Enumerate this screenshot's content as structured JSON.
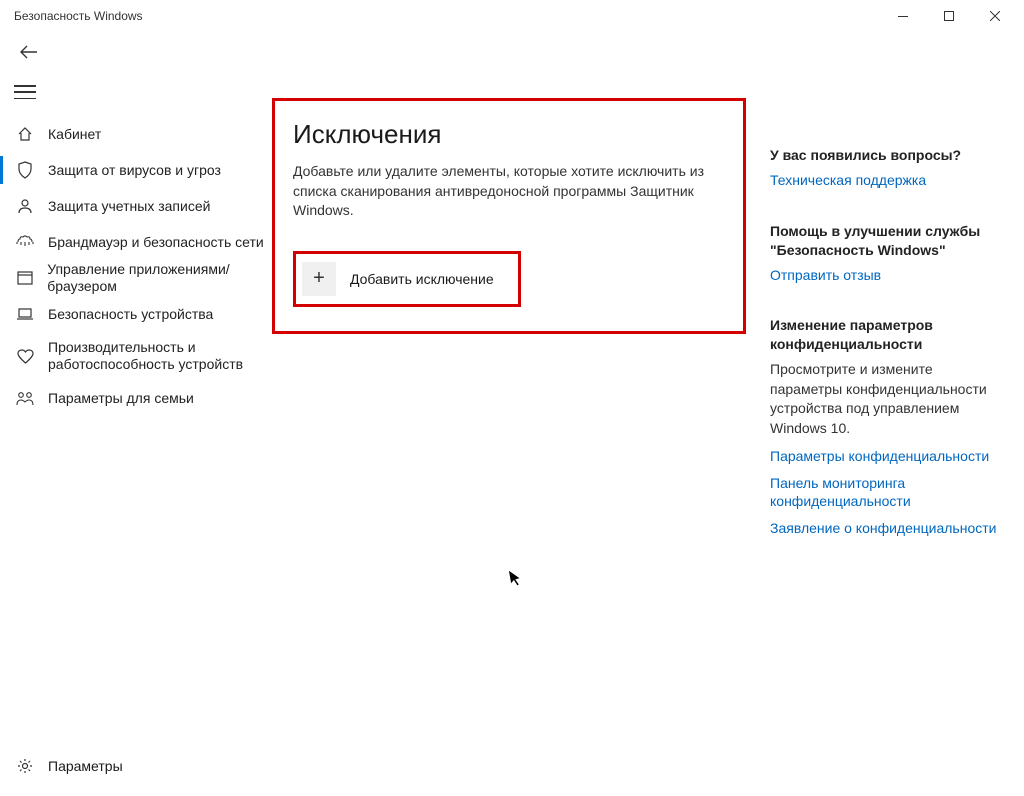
{
  "window": {
    "title": "Безопасность Windows"
  },
  "sidebar": {
    "items": [
      {
        "label": "Кабинет",
        "icon": "home"
      },
      {
        "label": "Защита от вирусов и угроз",
        "icon": "shield"
      },
      {
        "label": "Защита учетных записей",
        "icon": "account"
      },
      {
        "label": "Брандмауэр и безопасность сети",
        "icon": "firewall"
      },
      {
        "label": "Управление приложениями/браузером",
        "icon": "appctrl"
      },
      {
        "label": "Безопасность устройства",
        "icon": "device"
      },
      {
        "label": "Производительность и работоспособность устройств",
        "icon": "health"
      },
      {
        "label": "Параметры для семьи",
        "icon": "family"
      }
    ]
  },
  "settings": {
    "label": "Параметры"
  },
  "main": {
    "title": "Исключения",
    "description": "Добавьте или удалите элементы, которые хотите исключить из списка сканирования антивредоносной программы Защитник Windows.",
    "add_button": "Добавить исключение"
  },
  "right": {
    "s1_title": "У вас появились вопросы?",
    "s1_link": "Техническая поддержка",
    "s2_title": "Помощь в улучшении службы \"Безопасность Windows\"",
    "s2_link": "Отправить отзыв",
    "s3_title": "Изменение параметров конфиденциальности",
    "s3_desc": "Просмотрите и измените параметры конфиденциальности устройства под управлением Windows 10.",
    "s3_link1": "Параметры конфиденциальности",
    "s3_link2": "Панель мониторинга конфиденциальности",
    "s3_link3": "Заявление о конфиденциальности"
  }
}
